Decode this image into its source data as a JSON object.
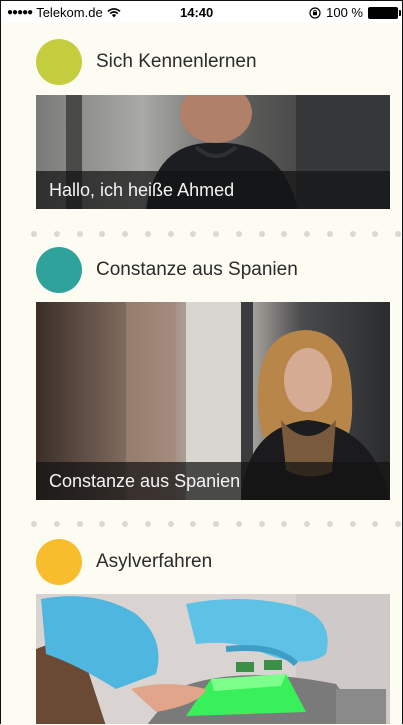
{
  "status_bar": {
    "carrier": "Telekom.de",
    "time": "14:40",
    "battery": "100 %"
  },
  "sections": [
    {
      "title": "Sich Kennenlernen",
      "color": "#c4cd3e",
      "caption": "Hallo, ich heiße Ahmed"
    },
    {
      "title": "Constanze aus Spanien",
      "color": "#2fa39b",
      "caption": "Constanze aus Spanien"
    },
    {
      "title": "Asylverfahren",
      "color": "#f7bd2c",
      "caption": ""
    }
  ]
}
